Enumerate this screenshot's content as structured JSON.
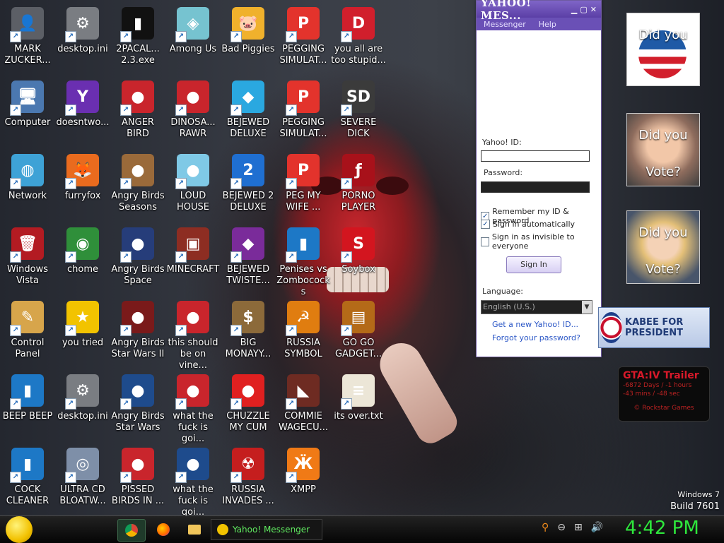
{
  "desktop": {
    "icons": [
      {
        "label": "MARK ZUCKER...",
        "glyph": "👤",
        "bg": "#5c5f66"
      },
      {
        "label": "desktop.ini",
        "glyph": "⚙",
        "bg": "#7a7d82"
      },
      {
        "label": "2PACAL... 2.3.exe",
        "glyph": "▮",
        "bg": "#111"
      },
      {
        "label": "Among Us",
        "glyph": "◈",
        "bg": "#76c3d0"
      },
      {
        "label": "Bad Piggies",
        "glyph": "🐷",
        "bg": "#f0b12c"
      },
      {
        "label": "PEGGING SIMULAT...",
        "glyph": "P",
        "bg": "#e3332c"
      },
      {
        "label": "you all are too stupid...",
        "glyph": "D",
        "bg": "#d11f2c"
      },
      {
        "label": "Computer",
        "glyph": "🖥",
        "bg": "#4b78b0"
      },
      {
        "label": "doesntwo...",
        "glyph": "Y",
        "bg": "#6a2fb1"
      },
      {
        "label": "ANGER BIRD",
        "glyph": "●",
        "bg": "#c9252c"
      },
      {
        "label": "DINOSA... RAWR",
        "glyph": "●",
        "bg": "#c9252c"
      },
      {
        "label": "BEJEWED DELUXE",
        "glyph": "◆",
        "bg": "#2aa8e0"
      },
      {
        "label": "PEGGING SIMULAT...",
        "glyph": "P",
        "bg": "#e3332c"
      },
      {
        "label": "SEVERE DICK",
        "glyph": "SD",
        "bg": "#3b3b3b"
      },
      {
        "label": "Network",
        "glyph": "◍",
        "bg": "#3ea2d6"
      },
      {
        "label": "furryfox",
        "glyph": "🦊",
        "bg": "#e96b1e"
      },
      {
        "label": "Angry Birds Seasons",
        "glyph": "●",
        "bg": "#9a6a3a"
      },
      {
        "label": "LOUD HOUSE",
        "glyph": "●",
        "bg": "#7fc9e6"
      },
      {
        "label": "BEJEWED 2 DELUXE",
        "glyph": "2",
        "bg": "#1f6fd1"
      },
      {
        "label": "PEG MY WIFE ...",
        "glyph": "P",
        "bg": "#e3332c"
      },
      {
        "label": "PORNO PLAYER",
        "glyph": "ƒ",
        "bg": "#a8111a"
      },
      {
        "label": "Windows Vista",
        "glyph": "🗑",
        "bg": "#b31b22"
      },
      {
        "label": "chome",
        "glyph": "◉",
        "bg": "#2f8f3a"
      },
      {
        "label": "Angry Birds Space",
        "glyph": "●",
        "bg": "#263d7a"
      },
      {
        "label": "MINECRAFT",
        "glyph": "▣",
        "bg": "#8d2d22"
      },
      {
        "label": "BEJEWED TWISTE...",
        "glyph": "◆",
        "bg": "#7a2b9a"
      },
      {
        "label": "Penises vs Zombococks",
        "glyph": "▮",
        "bg": "#1d78c6"
      },
      {
        "label": "Soybox",
        "glyph": "S",
        "bg": "#d3151f"
      },
      {
        "label": "Control Panel",
        "glyph": "✎",
        "bg": "#d7a54b"
      },
      {
        "label": "you tried",
        "glyph": "★",
        "bg": "#f2c300"
      },
      {
        "label": "Angry Birds Star Wars II",
        "glyph": "●",
        "bg": "#7a1a1a"
      },
      {
        "label": "this should be on vine...",
        "glyph": "●",
        "bg": "#c9252c"
      },
      {
        "label": "BIG MONAYY...",
        "glyph": "$",
        "bg": "#8c6a3a"
      },
      {
        "label": "RUSSIA SYMBOL",
        "glyph": "☭",
        "bg": "#e07d10"
      },
      {
        "label": "GO GO GADGET...",
        "glyph": "▤",
        "bg": "#b46a18"
      },
      {
        "label": "BEEP BEEP",
        "glyph": "▮",
        "bg": "#1d78c6"
      },
      {
        "label": "desktop.ini",
        "glyph": "⚙",
        "bg": "#7a7d82"
      },
      {
        "label": "Angry Birds Star Wars",
        "glyph": "●",
        "bg": "#1e4b8c"
      },
      {
        "label": "what the fuck is goi...",
        "glyph": "●",
        "bg": "#c9252c"
      },
      {
        "label": "CHUZZLE MY CUM",
        "glyph": "●",
        "bg": "#e02020"
      },
      {
        "label": "COMMIE WAGECU...",
        "glyph": "◣",
        "bg": "#6e2b22"
      },
      {
        "label": "its over.txt",
        "glyph": "≡",
        "bg": "#ece6d7"
      },
      {
        "label": "COCK CLEANER",
        "glyph": "▮",
        "bg": "#1d78c6"
      },
      {
        "label": "ULTRA CD BLOATW...",
        "glyph": "◎",
        "bg": "#7e8fa8"
      },
      {
        "label": "PISSED BIRDS IN ...",
        "glyph": "●",
        "bg": "#c9252c"
      },
      {
        "label": "what the fuck is goi...",
        "glyph": "●",
        "bg": "#1e4b8c"
      },
      {
        "label": "RUSSIA INVADES ...",
        "glyph": "☢",
        "bg": "#c51e1e"
      },
      {
        "label": "XMPP",
        "glyph": "Ӝ",
        "bg": "#f07a16"
      }
    ]
  },
  "yahoo": {
    "title": "YAHOO! MES...",
    "menu": [
      "Messenger",
      "Help"
    ],
    "id_label": "Yahoo! ID:",
    "password_label": "Password:",
    "remember": "Remember my ID & password",
    "auto": "Sign in automatically",
    "invisible": "Sign in as invisible to everyone",
    "signin": "Sign In",
    "language_label": "Language:",
    "language_value": "English (U.S.)",
    "new_id": "Get a new Yahoo! ID...",
    "forgot": "Forgot your password?"
  },
  "gadgets": {
    "vote1_top": "Did you",
    "vote2_top": "Did you",
    "vote2_bottom": "Vote?",
    "vote3_top": "Did you",
    "vote3_bottom": "Vote?",
    "huck": "KABEE FOR PRESIDENT",
    "gta_title": "GTA:IV Trailer",
    "gta_line1": "-6872 Days / -1 hours",
    "gta_line2": "-43 mins / -48 sec",
    "gta_footer": "© Rockstar Games"
  },
  "watermark": {
    "line1": "Windows 7",
    "line2": "Build 7601"
  },
  "taskbar": {
    "ym_button": "Yahoo! Messenger",
    "clock": "4:42 PM"
  },
  "colors": {
    "accent_yahoo": "#6a50b6",
    "clock_green": "#2ee83c"
  }
}
